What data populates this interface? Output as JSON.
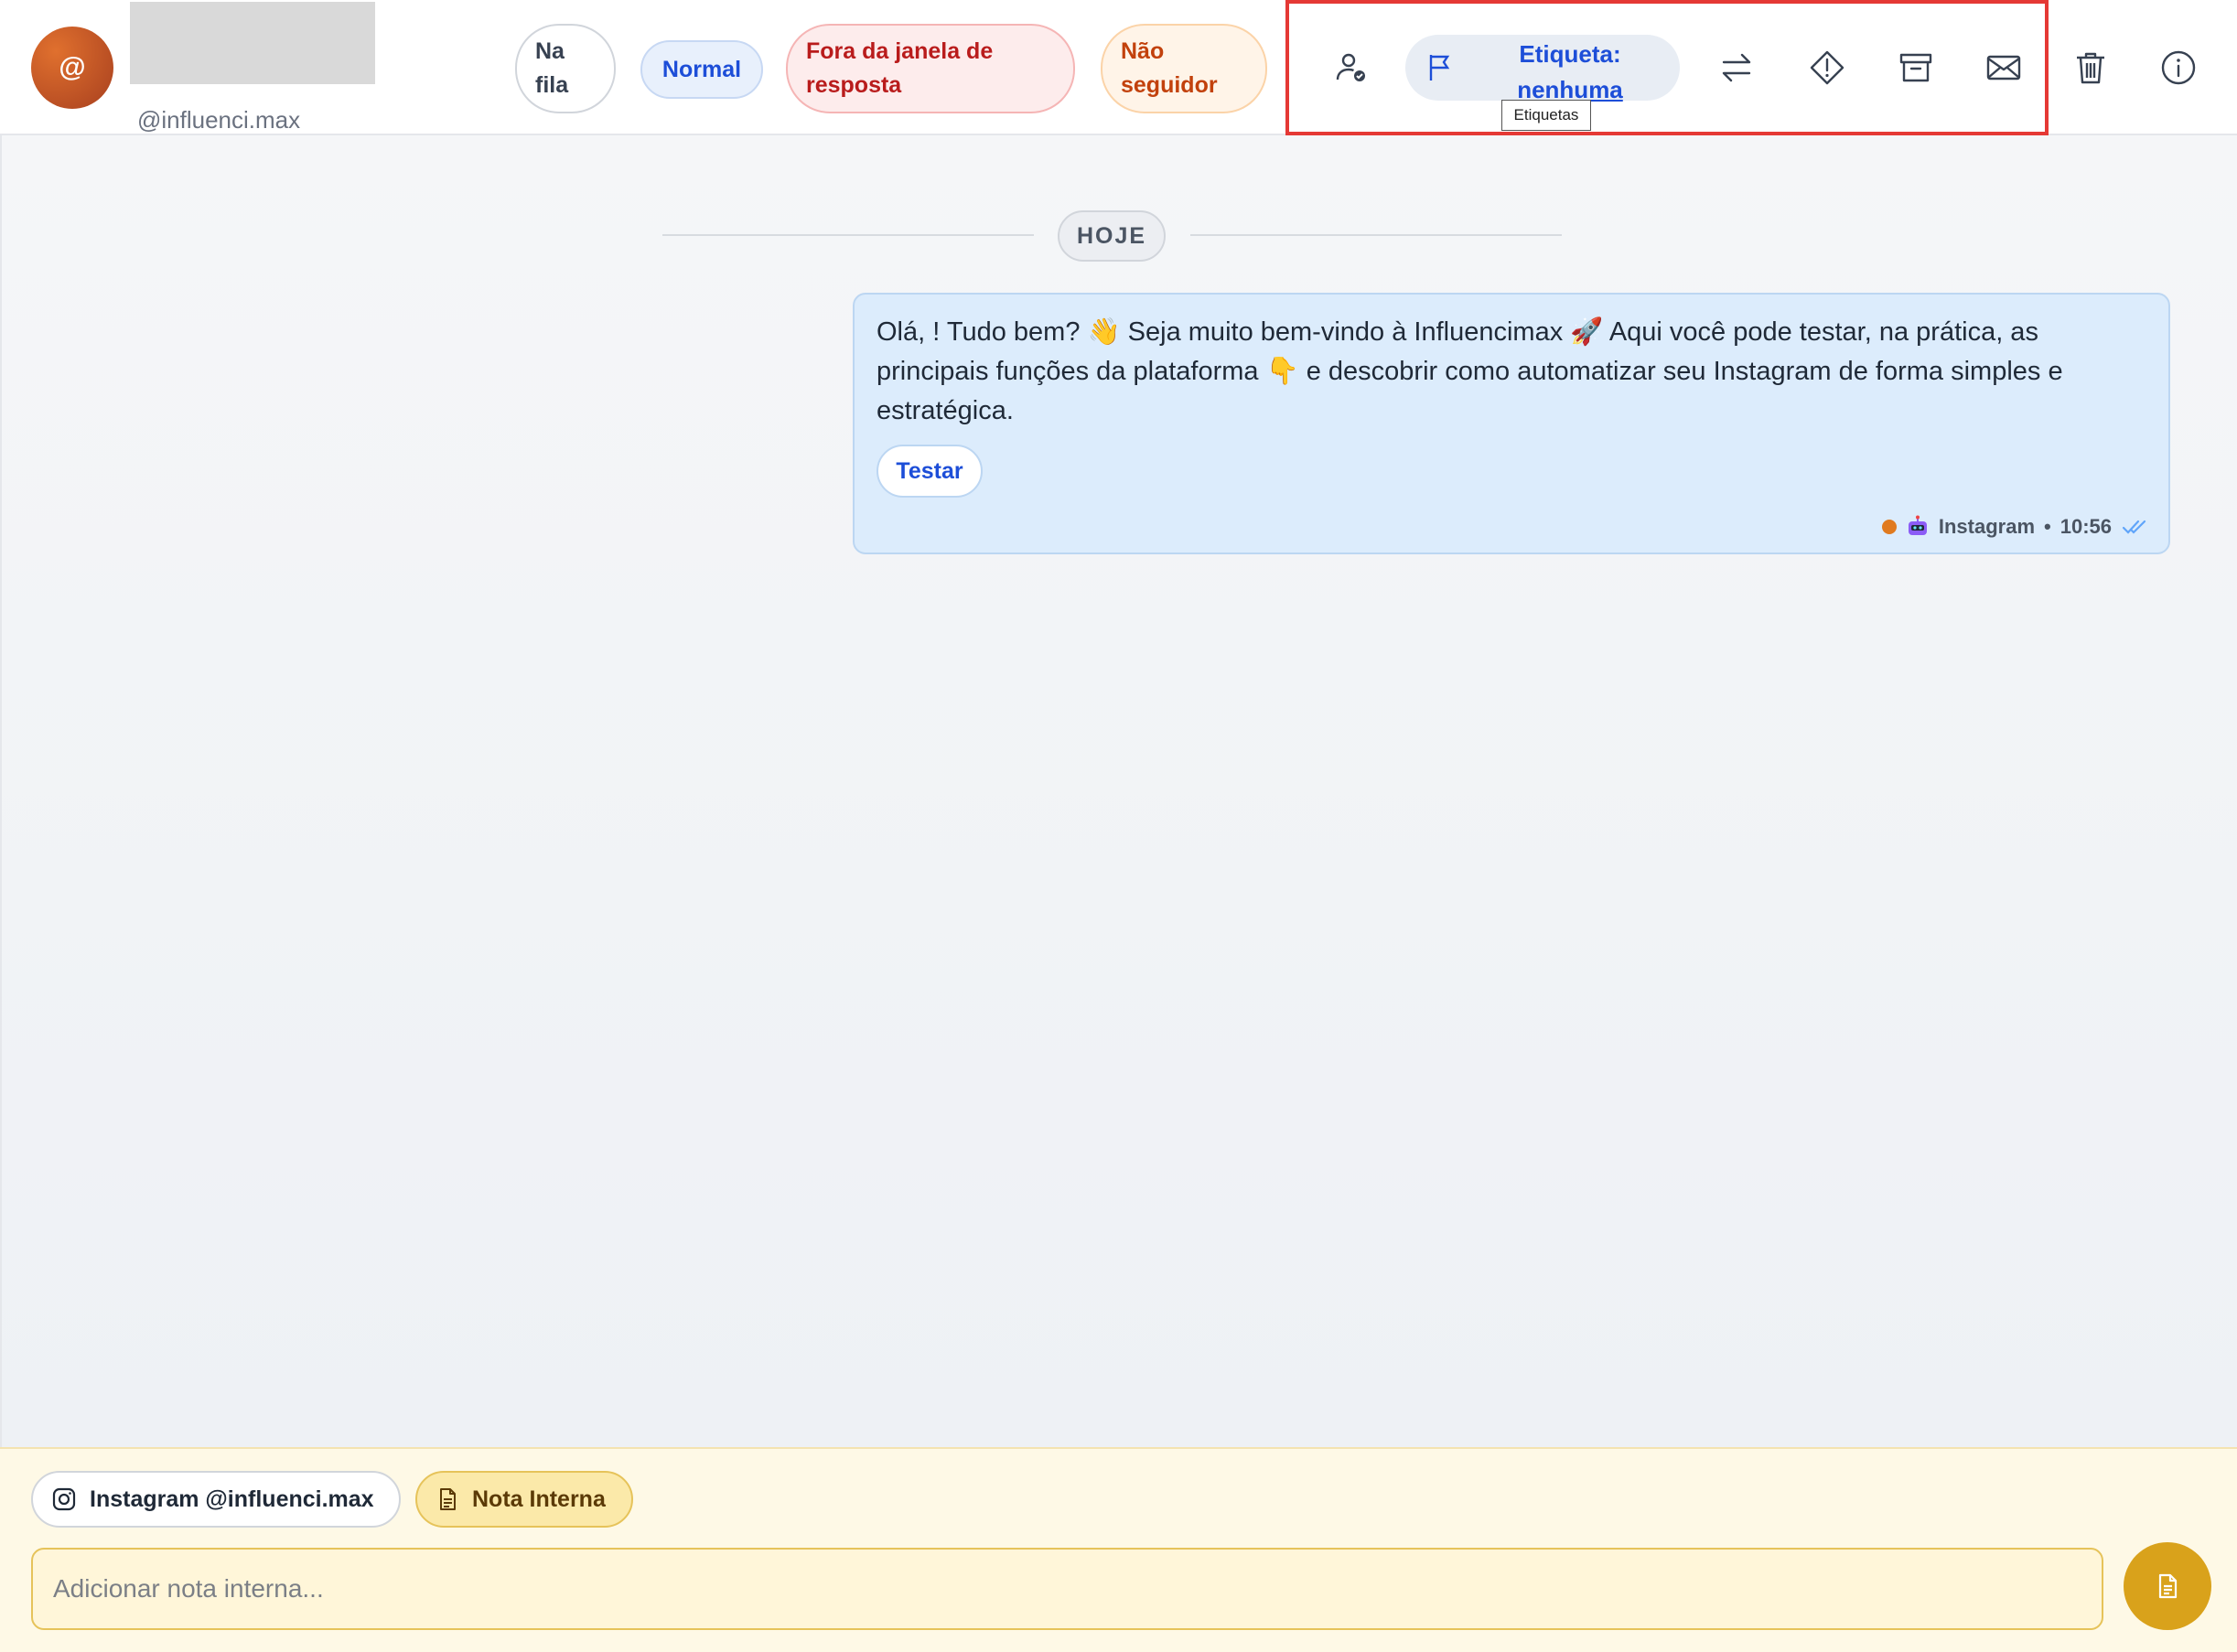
{
  "header": {
    "avatar_symbol": "@",
    "handle": "@influenci.max",
    "pills": {
      "queue": "Na fila",
      "priority": "Normal",
      "window": "Fora da janela de resposta",
      "follower": "Não seguidor"
    },
    "label_button": {
      "line1": "Etiqueta:",
      "line2": "nenhuma",
      "tooltip": "Etiquetas"
    },
    "icons": [
      "user-check-icon",
      "flag-icon",
      "transfer-icon",
      "warning-diamond-icon",
      "archive-icon",
      "envelope-icon",
      "trash-icon",
      "info-icon"
    ],
    "highlight_color": "#e53935"
  },
  "chat": {
    "day_label": "HOJE",
    "message": {
      "text": "Olá, ! Tudo bem? 👋 Seja muito bem-vindo à Influencimax 🚀 Aqui você pode testar, na prática, as principais funções da plataforma 👇 e descobrir como automatizar seu Instagram de forma simples e estratégica.",
      "button_label": "Testar",
      "channel": "Instagram",
      "time": "10:56",
      "status_color": "#e07a1f"
    }
  },
  "composer": {
    "channel_chip": "Instagram @influenci.max",
    "note_chip": "Nota Interna",
    "input_placeholder": "Adicionar nota interna...",
    "accent_color": "#d9a21b"
  }
}
